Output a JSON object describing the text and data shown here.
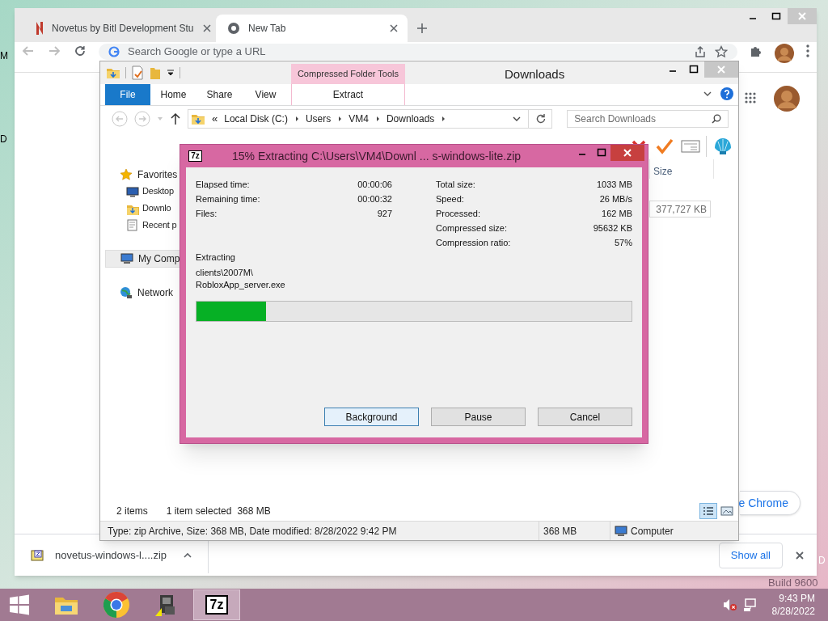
{
  "desktop_fragments": [
    {
      "text": "M"
    },
    {
      "text": "D"
    },
    {
      "text": "D"
    }
  ],
  "build_text": "Build 9600",
  "browser": {
    "tabs": [
      {
        "title": "Novetus by Bitl Development Stu",
        "kind": "novetus",
        "selected": false
      },
      {
        "title": "New Tab",
        "kind": "newtab",
        "selected": true
      }
    ],
    "omnibox": {
      "placeholder": "Search Google or type a URL"
    },
    "promo_button": "e Chrome",
    "download_bar": {
      "file": "novetus-windows-l....zip",
      "show_all": "Show all"
    }
  },
  "explorer": {
    "title": "Downloads",
    "context_group": "Compressed Folder Tools",
    "ribbon_tabs": [
      {
        "label": "File",
        "kind": "file"
      },
      {
        "label": "Home",
        "kind": "tab"
      },
      {
        "label": "Share",
        "kind": "tab"
      },
      {
        "label": "View",
        "kind": "tab"
      },
      {
        "label": "Extract",
        "kind": "context"
      }
    ],
    "breadcrumb_overflow": "«",
    "breadcrumb": [
      "Local Disk (C:)",
      "Users",
      "VM4",
      "Downloads"
    ],
    "search": {
      "placeholder": "Search Downloads"
    },
    "nav": [
      {
        "label": "Favorites",
        "kind": "star",
        "selected": false,
        "children": [
          {
            "label": "Desktop",
            "kind": "desktop",
            "selected": false
          },
          {
            "label": "Downlo",
            "kind": "downloads",
            "selected": false
          },
          {
            "label": "Recent p",
            "kind": "recent",
            "selected": false
          }
        ]
      },
      {
        "label": "My Comp",
        "kind": "computer",
        "selected": true
      },
      {
        "label": "Network",
        "kind": "network",
        "selected": false
      }
    ],
    "columns": [
      "Size"
    ],
    "cell": "377,727 KB",
    "status": {
      "count": "2 items",
      "selection": "1 item selected",
      "selection_size": "368 MB"
    },
    "details_bar": {
      "info": "Type: zip Archive, Size: 368 MB, Date modified: 8/28/2022 9:42 PM",
      "size": "368 MB",
      "location": "Computer"
    }
  },
  "dialog": {
    "icon_text": "7z",
    "title": "15% Extracting C:\\Users\\VM4\\Downl ... s-windows-lite.zip",
    "stats_left": [
      {
        "label": "Elapsed time:",
        "value": "00:00:06"
      },
      {
        "label": "Remaining time:",
        "value": "00:00:32"
      },
      {
        "label": "Files:",
        "value": "927"
      }
    ],
    "stats_right": [
      {
        "label": "Total size:",
        "value": "1033 MB"
      },
      {
        "label": "Speed:",
        "value": "26 MB/s"
      },
      {
        "label": "Processed:",
        "value": "162 MB"
      },
      {
        "label": "Compressed size:",
        "value": "95632 KB"
      },
      {
        "label": "Compression ratio:",
        "value": "57%"
      }
    ],
    "status_label": "Extracting",
    "current_file": [
      "clients\\2007M\\",
      "RobloxApp_server.exe"
    ],
    "progress": {
      "level": 0.16
    },
    "buttons": [
      {
        "label": "Background",
        "focused": true
      },
      {
        "label": "Pause",
        "focused": false
      },
      {
        "label": "Cancel",
        "focused": false
      }
    ]
  },
  "taskbar": {
    "apps": [
      {
        "kind": "explorer",
        "selected": false
      },
      {
        "kind": "chrome",
        "selected": false
      },
      {
        "kind": "novetus",
        "selected": false
      },
      {
        "kind": "sevenzip",
        "label": "7z",
        "selected": true
      }
    ],
    "tray": {
      "time": "9:43 PM",
      "date": "8/28/2022"
    }
  }
}
